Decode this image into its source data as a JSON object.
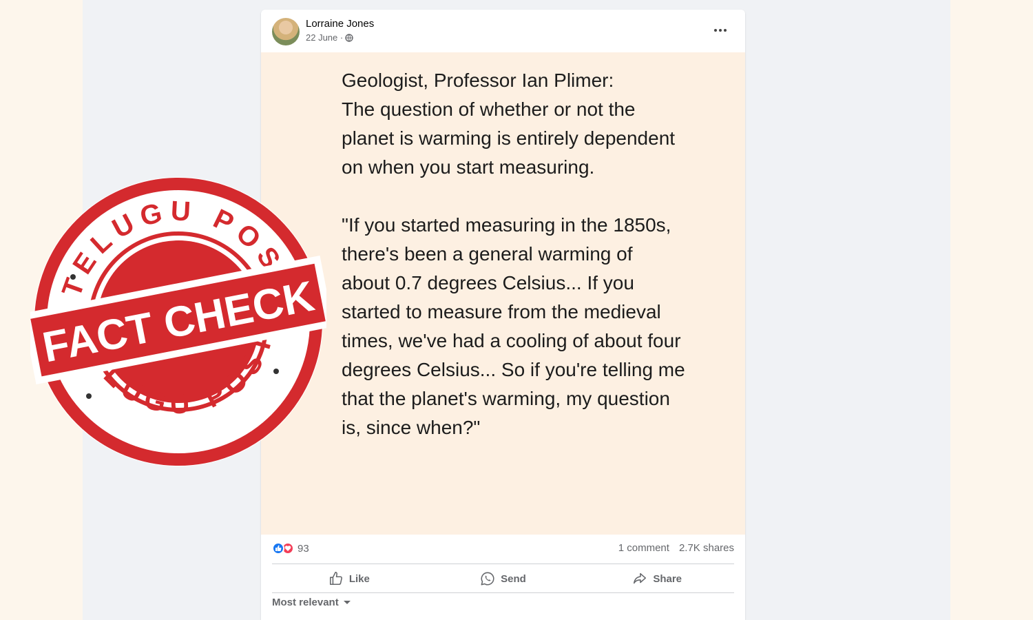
{
  "post": {
    "author": "Lorraine Jones",
    "date": "22 June ·",
    "more_icon": "more-icon",
    "body_text": "Geologist, Professor Ian Plimer:\nThe question of whether or not the planet is warming is entirely dependent on when you start measuring.\n\n\"If you started measuring in the 1850s, there's been a general warming of about 0.7 degrees Celsius... If you started to measure from the medieval times, we've had a cooling of about four degrees Celsius... So if you're telling me that the planet's warming, my question is, since when?\"",
    "reactions_count": "93",
    "comments": "1 comment",
    "shares": "2.7K shares",
    "actions": {
      "like": "Like",
      "send": "Send",
      "share": "Share"
    },
    "sort_label": "Most relevant"
  },
  "stamp": {
    "top_text": "TELUGU POST",
    "center_text": "FACT CHECK",
    "bottom_text": "TELUGU POST",
    "color": "#d42a2e"
  },
  "colors": {
    "post_body_bg": "#fdf0e2",
    "accent_blue": "#1877f2",
    "love_red": "#f33e58"
  }
}
